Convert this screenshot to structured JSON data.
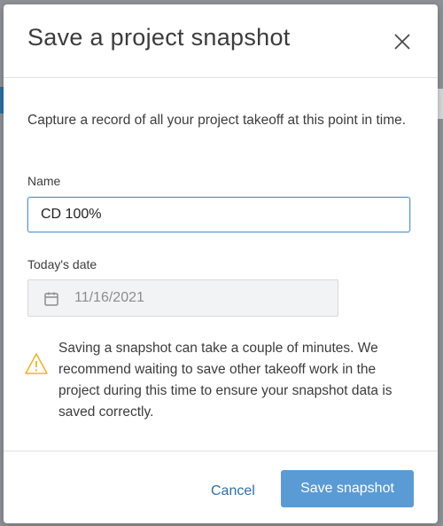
{
  "dialog": {
    "title": "Save a project snapshot",
    "intro": "Capture a record of all your project takeoff at this point in time.",
    "name_label": "Name",
    "name_value": "CD 100%",
    "date_label": "Today's date",
    "date_value": "11/16/2021",
    "warning_text": "Saving a snapshot can take a couple of minutes. We recommend waiting to save other takeoff work in the project during this time to ensure your snapshot data is saved correctly.",
    "cancel_label": "Cancel",
    "save_label": "Save snapshot"
  },
  "icons": {
    "close": "close-icon",
    "calendar": "calendar-icon",
    "warning": "warning-icon"
  },
  "colors": {
    "accent": "#5a9bd6",
    "link": "#2d6fa8",
    "warning": "#f0b429",
    "focus_border": "#5d97cf"
  }
}
